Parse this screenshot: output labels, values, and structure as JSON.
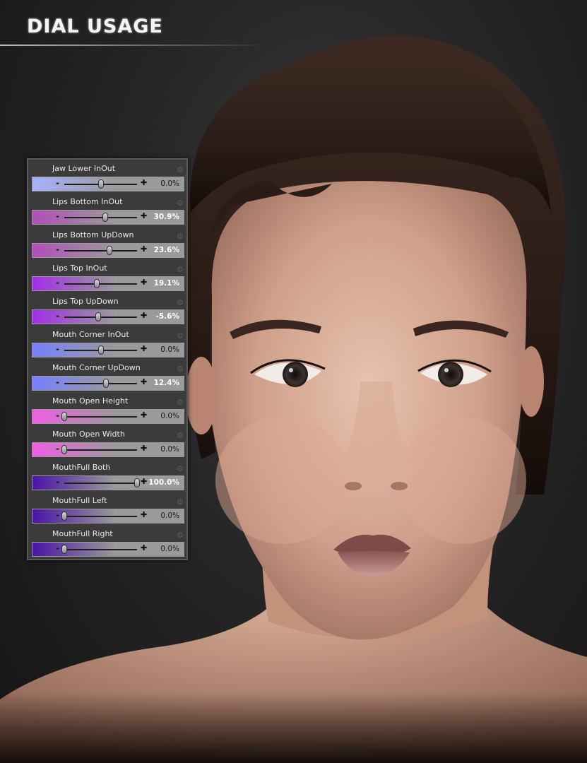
{
  "title": "DIAL USAGE",
  "dials": [
    {
      "label": "Jaw Lower InOut",
      "value": "0.0%",
      "fraction": 0.5,
      "color": "#a6b2ff",
      "bright": false
    },
    {
      "label": "Lips Bottom InOut",
      "value": "30.9%",
      "fraction": 0.56,
      "color": "#b14fb8",
      "bright": true
    },
    {
      "label": "Lips Bottom UpDown",
      "value": "23.6%",
      "fraction": 0.62,
      "color": "#b14fb8",
      "bright": true
    },
    {
      "label": "Lips Top InOut",
      "value": "19.1%",
      "fraction": 0.45,
      "color": "#a22ee6",
      "bright": true
    },
    {
      "label": "Lips Top UpDown",
      "value": "-5.6%",
      "fraction": 0.47,
      "color": "#a22ee6",
      "bright": true
    },
    {
      "label": "Mouth Corner InOut",
      "value": "0.0%",
      "fraction": 0.5,
      "color": "#7780ff",
      "bright": false
    },
    {
      "label": "Mouth Corner UpDown",
      "value": "12.4%",
      "fraction": 0.57,
      "color": "#7780ff",
      "bright": true
    },
    {
      "label": "Mouth Open Height",
      "value": "0.0%",
      "fraction": 0.0,
      "color": "#ef5fe4",
      "bright": false
    },
    {
      "label": "Mouth Open Width",
      "value": "0.0%",
      "fraction": 0.0,
      "color": "#ef5fe4",
      "bright": false
    },
    {
      "label": "MouthFull Both",
      "value": "100.0%",
      "fraction": 1.0,
      "color": "#4a14a6",
      "bright": true
    },
    {
      "label": "MouthFull Left",
      "value": "0.0%",
      "fraction": 0.0,
      "color": "#4a14a6",
      "bright": false
    },
    {
      "label": "MouthFull Right",
      "value": "0.0%",
      "fraction": 0.0,
      "color": "#4a14a6",
      "bright": false
    }
  ],
  "icons": {
    "gear": "gear-icon",
    "minus": "minus-icon",
    "plus": "plus-icon"
  }
}
